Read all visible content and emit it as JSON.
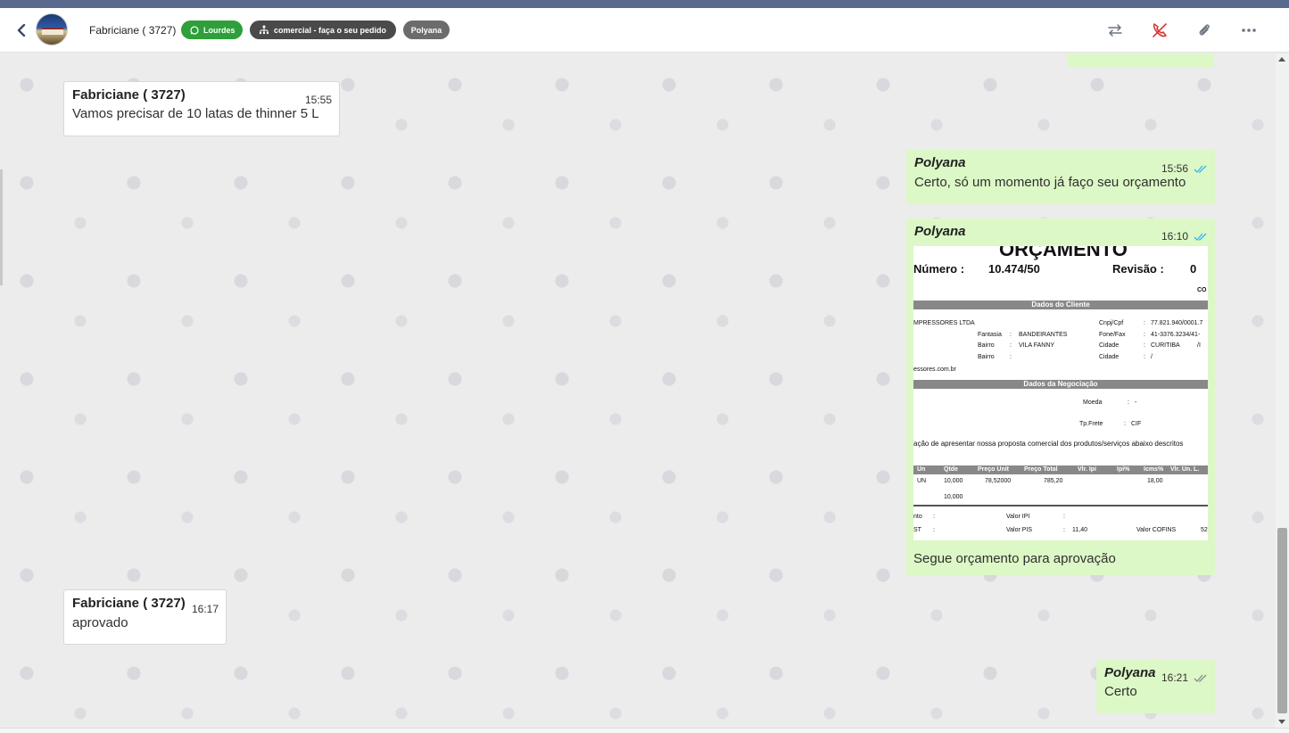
{
  "header": {
    "contact_name": "Fabriciane ( 3727)",
    "tags": [
      {
        "label": "Lourdes",
        "color": "#2e9f3a",
        "icon": "whatsapp-icon"
      },
      {
        "label": "comercial - faça o seu pedido",
        "color": "#4a4a4a",
        "icon": "sitemap-icon"
      },
      {
        "label": "Polyana",
        "color": "#6c6c6c"
      }
    ],
    "actions": [
      "transfer-icon",
      "end-call-icon",
      "attachment-icon",
      "more-icon"
    ]
  },
  "messages": [
    {
      "direction": "in",
      "sender": "Fabriciane ( 3727)",
      "time": "15:55",
      "text": "Vamos precisar de 10 latas de thinner 5 L"
    },
    {
      "direction": "out",
      "sender": "Polyana",
      "time": "15:56",
      "status": "read",
      "text": "Certo, só um momento já faço seu orçamento"
    },
    {
      "direction": "out",
      "sender": "Polyana",
      "time": "16:10",
      "status": "read",
      "caption": "Segue orçamento para aprovação",
      "attachment": {
        "title": "ORÇAMENTO",
        "numero_label": "Número :",
        "numero": "10.474/50",
        "revisao_label": "Revisão :",
        "revisao": "0",
        "co": "CO",
        "section_cliente": "Dados do Cliente",
        "cliente_nome": "MPRESSORES LTDA",
        "cnpj_label": "Cnpj/Cpf",
        "cnpj": "77.821.940/0001.7",
        "fantasia_label": "Fantasia",
        "fantasia": "BANDEIRANTES",
        "fone_label": "Fone/Fax",
        "fone": "41-3376.3234/41-",
        "bairro_label": "Bairro",
        "bairro": "VILA FANNY",
        "cidade_label": "Cidade",
        "cidade": "CURITIBA",
        "cidade_extra": "/I",
        "bairro2_label": "Bairro",
        "cidade2_label": "Cidade",
        "cidade2": "/",
        "email": "essores.com.br",
        "section_negociacao": "Dados da Negociação",
        "moeda_label": "Moeda",
        "moeda": "-",
        "frete_label": "Tp.Frete",
        "frete": "CIF",
        "proposta_text": "ação de apresentar nossa proposta comercial dos produtos/serviços abaixo descritos",
        "table_headers": [
          "Un",
          "Qtde",
          "Preço Unit",
          "Preço Total",
          "Vlr. Ipi",
          "Ipi%",
          "Icms%",
          "Vlr. Un. L."
        ],
        "row": [
          "UN",
          "10,000",
          "78,52000",
          "785,20",
          "",
          "",
          "18,00",
          ""
        ],
        "total_qtde": "10,000",
        "footer_a1": "nto",
        "footer_a2": "ST",
        "valor_ipi_label": "Valor IPI",
        "valor_pis_label": "Valor PIS",
        "valor_pis": "11,40",
        "valor_cofins_label": "Valor COFINS",
        "valor_cofins": "52"
      }
    },
    {
      "direction": "in",
      "sender": "Fabriciane ( 3727)",
      "time": "16:17",
      "text": "aprovado"
    },
    {
      "direction": "out",
      "sender": "Polyana",
      "time": "16:21",
      "status": "delivered",
      "text": "Certo"
    }
  ]
}
